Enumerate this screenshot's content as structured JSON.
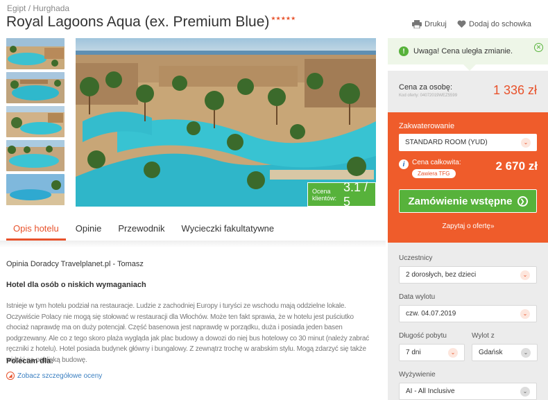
{
  "breadcrumb": {
    "country": "Egipt",
    "separator": "/",
    "city": "Hurghada"
  },
  "hotel": {
    "name": "Royal Lagoons Aqua (ex. Premium Blue)",
    "stars": "★★★★★"
  },
  "actions": {
    "print": "Drukuj",
    "favorite": "Dodaj do schowka"
  },
  "rating": {
    "label_line1": "Ocena",
    "label_line2": "klientów:",
    "value": "3.1 / 5"
  },
  "tabs": [
    {
      "label": "Opis hotelu",
      "active": true
    },
    {
      "label": "Opinie",
      "active": false
    },
    {
      "label": "Przewodnik",
      "active": false
    },
    {
      "label": "Wycieczki fakultatywne",
      "active": false
    }
  ],
  "description": {
    "advisor": "Opinia Doradcy Travelplanet.pl - Tomasz",
    "subtitle": "Hotel dla osób o niskich wymaganiach",
    "body": "Istnieje w tym hotelu podział na restauracje. Ludzie z zachodniej Europy i turyści ze wschodu mają oddzielne lokale. Oczywiście Polacy nie mogą się stołować w restauracji dla Włochów. Może ten fakt sprawia, że w hotelu jest puściutko chociaż naprawdę ma on duży potencjał. Część basenowa jest naprawdę w porządku, duża i posiada jeden basen podgrzewany. Ale co z tego skoro plaża wygląda jak plac budowy a dowozi do niej bus hotelowy co 30 minut (należy zabrać ręczniki z hotelu). Hotel posiada budynek główny i bungalowy. Z zewnątrz trochę w arabskim stylu. Mogą zdarzyć się także widoki na pobliską budowę.",
    "recommend": "Polecam dla:",
    "scores_link": "Zobacz szczegółowe oceny"
  },
  "alert": {
    "text": "Uwaga! Cena uległa zmianie."
  },
  "price": {
    "label": "Cena za osobę:",
    "offer_code": "Kod oferty: 04072019WEZ5599",
    "value": "1 336 zł"
  },
  "booking": {
    "accommodation_label": "Zakwaterowanie",
    "room": "STANDARD ROOM (YUD)",
    "total_label": "Cena całkowita:",
    "tfg_badge": "Zawiera TFG",
    "total_value": "2 670 zł",
    "order_button": "Zamówienie wstępne",
    "ask_link": "Zapytaj o ofertę»"
  },
  "filters": {
    "participants_label": "Uczestnicy",
    "participants_value": "2 dorosłych, bez dzieci",
    "departure_label": "Data wylotu",
    "departure_value": "czw. 04.07.2019",
    "stay_label": "Długość pobytu",
    "stay_value": "7 dni",
    "from_label": "Wylot z",
    "from_value": "Gdańsk",
    "board_label": "Wyżywienie",
    "board_value": "AI - All Inclusive"
  },
  "colors": {
    "accent": "#ef5c2b",
    "green": "#57b23b",
    "link": "#3a7fc1"
  }
}
